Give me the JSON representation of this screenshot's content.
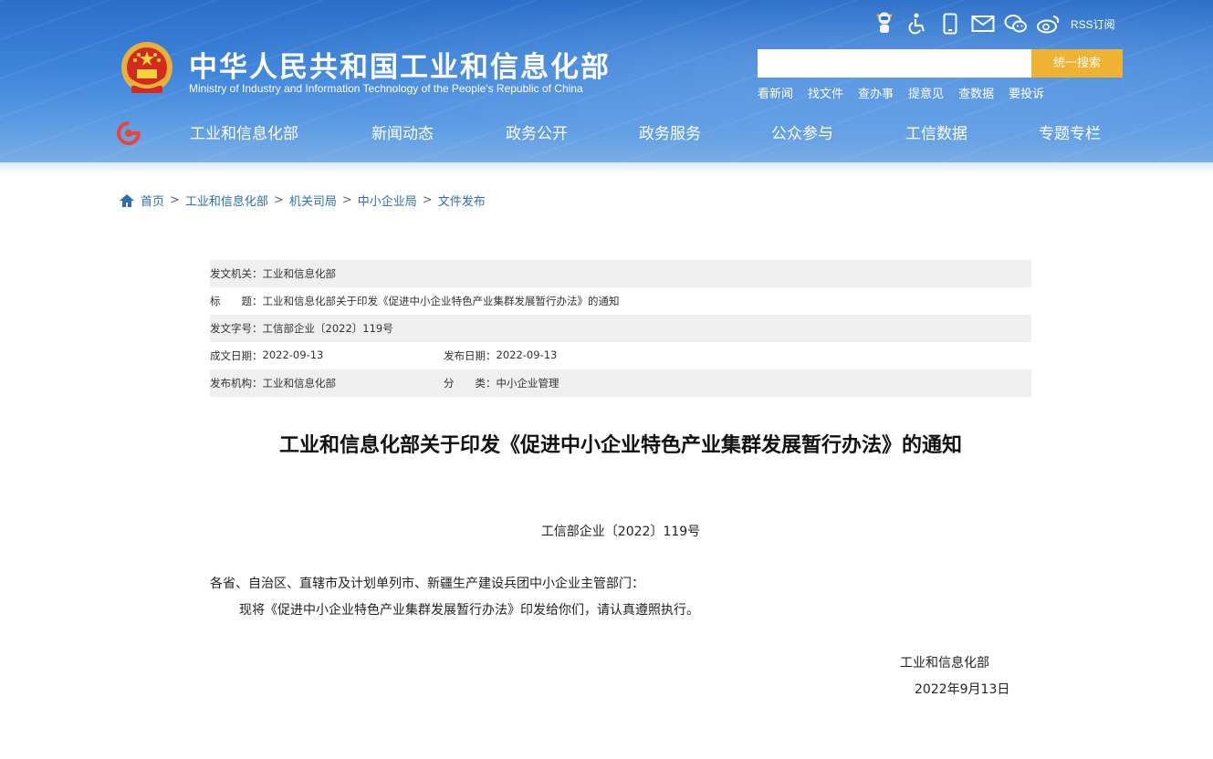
{
  "header": {
    "site_title": "中华人民共和国工业和信息化部",
    "site_subtitle": "Ministry of Industry and Information Technology of the People's Republic of China",
    "tool_icons": [
      "accessibility-robot-icon",
      "wheelchair-icon",
      "mobile-icon",
      "mail-icon",
      "wechat-icon",
      "weibo-icon"
    ],
    "rss_label": "RSS订阅",
    "search": {
      "placeholder": "",
      "button_label": "统一搜索"
    },
    "quick_links": [
      "看新闻",
      "找文件",
      "查办事",
      "提意见",
      "查数据",
      "要投诉"
    ],
    "nav": [
      "工业和信息化部",
      "新闻动态",
      "政务公开",
      "政务服务",
      "公众参与",
      "工信数据",
      "专题专栏"
    ],
    "colors": {
      "header_blue": "#3f86dc",
      "search_button": "#f0b233"
    }
  },
  "breadcrumb": [
    "首页",
    "工业和信息化部",
    "机关司局",
    "中小企业局",
    "文件发布"
  ],
  "info": {
    "issuer_label": "发文机关：",
    "issuer": "工业和信息化部",
    "title_label": "标　　题：",
    "title": "工业和信息化部关于印发《促进中小企业特色产业集群发展暂行办法》的通知",
    "doc_no_label": "发文字号：",
    "doc_no": "工信部企业〔2022〕119号",
    "written_label": "成文日期：",
    "written": "2022-09-13",
    "published_label": "发布日期：",
    "published": "2022-09-13",
    "org_label": "发布机构：",
    "org": "工业和信息化部",
    "category_label": "分　　类：",
    "category": "中小企业管理"
  },
  "article": {
    "title": "工业和信息化部关于印发《促进中小企业特色产业集群发展暂行办法》的通知",
    "doc_no": "工信部企业〔2022〕119号",
    "salutation": "各省、自治区、直辖市及计划单列市、新疆生产建设兵团中小企业主管部门：",
    "body": "现将《促进中小企业特色产业集群发展暂行办法》印发给你们，请认真遵照执行。",
    "sign_org": "工业和信息化部",
    "sign_date": "2022年9月13日"
  }
}
